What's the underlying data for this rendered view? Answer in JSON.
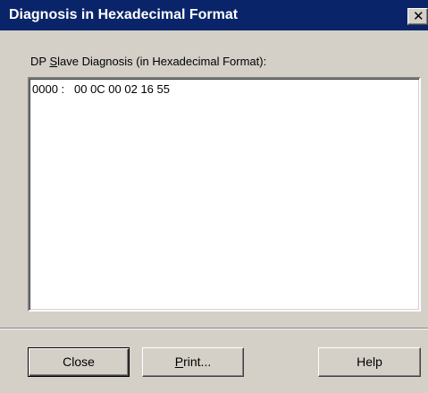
{
  "window": {
    "title": "Diagnosis in Hexadecimal Format",
    "close_glyph": "✕",
    "close_icon": "close-icon"
  },
  "diagnosis": {
    "label_prefix": "DP ",
    "label_mnemonic": "S",
    "label_rest": "lave Diagnosis (in Hexadecimal Format):",
    "lines": [
      {
        "address": "0000 :",
        "bytes": "00 0C 00 02 16 55"
      }
    ]
  },
  "buttons": {
    "close_label": "Close",
    "print_mnemonic": "P",
    "print_rest": "rint...",
    "help_label": "Help"
  },
  "colors": {
    "titlebar": "#0a246a",
    "face": "#d4d0c8",
    "title_text": "#ffffff"
  }
}
